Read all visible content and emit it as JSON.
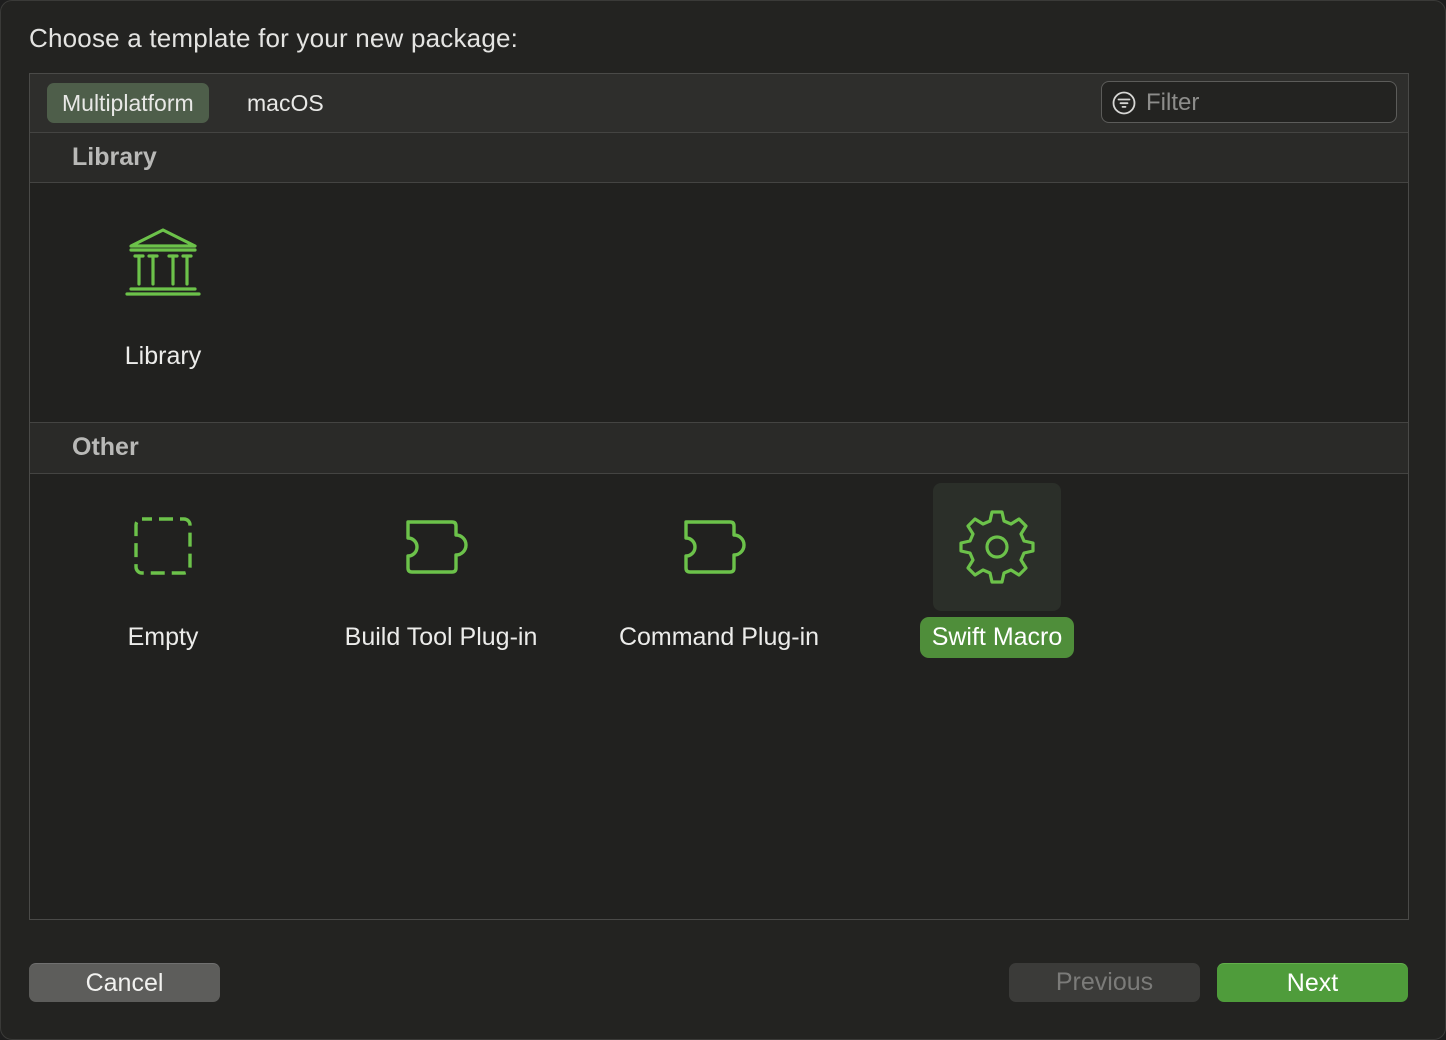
{
  "dialog": {
    "prompt": "Choose a template for your new package:"
  },
  "tabs": [
    {
      "label": "Multiplatform",
      "selected": true
    },
    {
      "label": "macOS",
      "selected": false
    }
  ],
  "filter": {
    "placeholder": "Filter",
    "value": "",
    "icon": "filter-icon"
  },
  "sections": [
    {
      "title": "Library",
      "items": [
        {
          "label": "Library",
          "icon": "library-columns-icon",
          "selected": false
        }
      ]
    },
    {
      "title": "Other",
      "items": [
        {
          "label": "Empty",
          "icon": "empty-dashed-square-icon",
          "selected": false
        },
        {
          "label": "Build Tool Plug-in",
          "icon": "puzzle-piece-icon",
          "selected": false
        },
        {
          "label": "Command Plug-in",
          "icon": "puzzle-piece-icon",
          "selected": false
        },
        {
          "label": "Swift Macro",
          "icon": "gear-icon",
          "selected": true
        }
      ]
    }
  ],
  "buttons": {
    "cancel": "Cancel",
    "previous": "Previous",
    "next": "Next"
  },
  "colors": {
    "accent_green": "#4f9c3b",
    "icon_green": "#6cc24a",
    "selected_label_bg": "#4f8e3a",
    "selected_tab_bg": "#4e5e4a"
  }
}
